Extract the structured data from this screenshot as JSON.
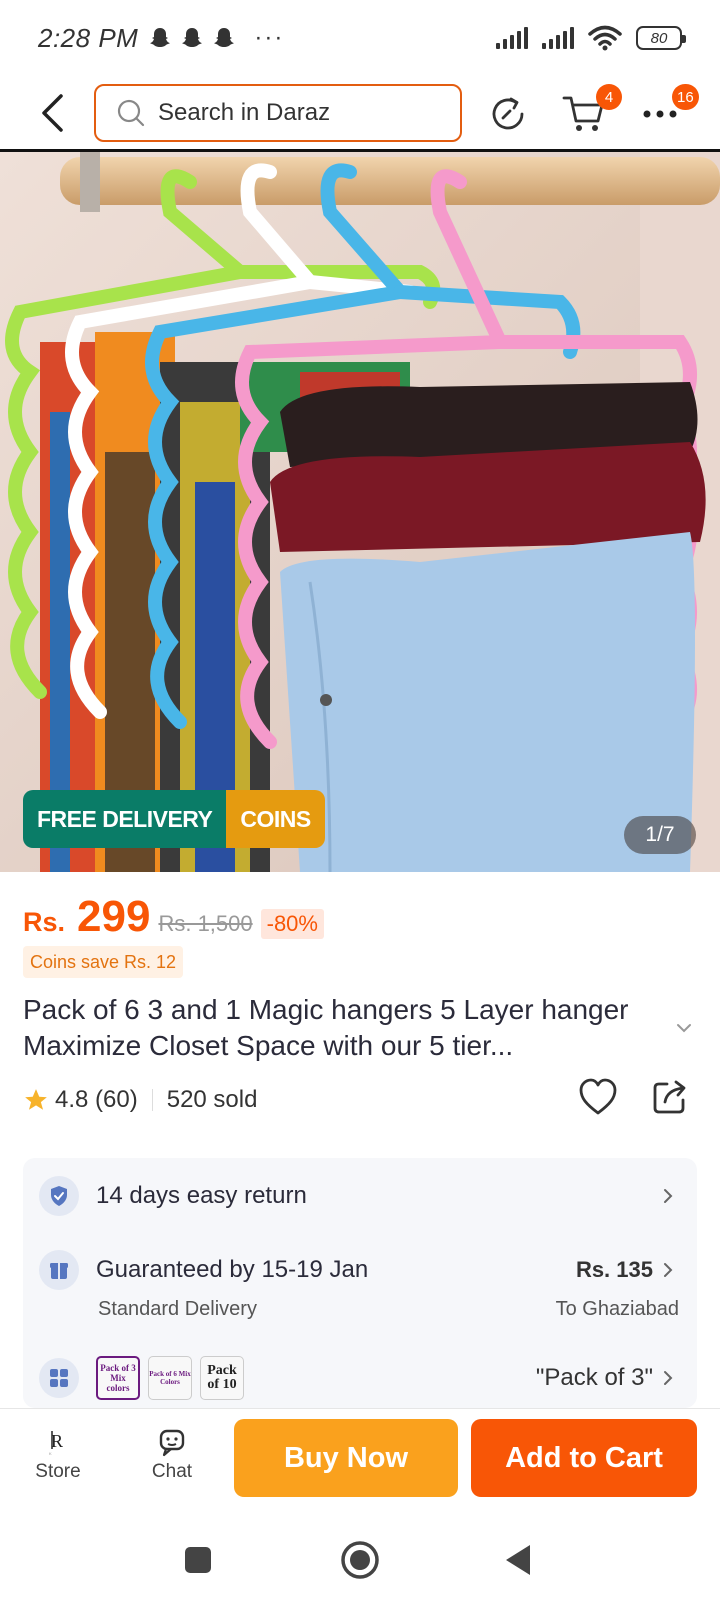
{
  "status_bar": {
    "time": "2:28 PM",
    "more": "···",
    "battery": "80",
    "icons": [
      "snapchat-icon",
      "snapchat-icon",
      "snapchat-icon",
      "signal-icon",
      "signal-icon",
      "wifi-icon",
      "battery-icon"
    ]
  },
  "header": {
    "search_placeholder": "Search in Daraz",
    "cart_badge": "4",
    "more_badge": "16",
    "icons": [
      "back-icon",
      "search-icon",
      "history-icon",
      "cart-icon",
      "more-icon"
    ]
  },
  "product_image": {
    "badge_free_delivery": "FREE DELIVERY",
    "badge_coins": "COINS",
    "counter": "1/7"
  },
  "price": {
    "currency": "Rs.",
    "current": "299",
    "original": "Rs. 1,500",
    "discount": "-80%",
    "coins_save": "Coins save Rs. 12"
  },
  "product": {
    "title": "Pack of 6 3 and 1 Magic hangers 5 Layer hanger Maximize Closet Space with our 5 tier...",
    "rating": "4.8 (60)",
    "sold": "520 sold"
  },
  "info": {
    "return_text": "14 days easy return",
    "delivery_text": "Guaranteed by 15-19 Jan",
    "delivery_type": "Standard Delivery",
    "delivery_fee": "Rs. 135",
    "delivery_to": "To Ghaziabad",
    "variant_selected": "\"Pack of 3\"",
    "variant_thumbs": [
      "Pack of 3 Mix colors",
      "Pack of 6 Mix Colors",
      "Pack of 10"
    ]
  },
  "bottom_bar": {
    "store_label": "Store",
    "chat_label": "Chat",
    "buy_now": "Buy Now",
    "add_to_cart": "Add to Cart"
  },
  "colors": {
    "brand_orange": "#f85606",
    "buy_now": "#faa11d",
    "free_delivery": "#0a7c67",
    "coins": "#e59b10"
  }
}
